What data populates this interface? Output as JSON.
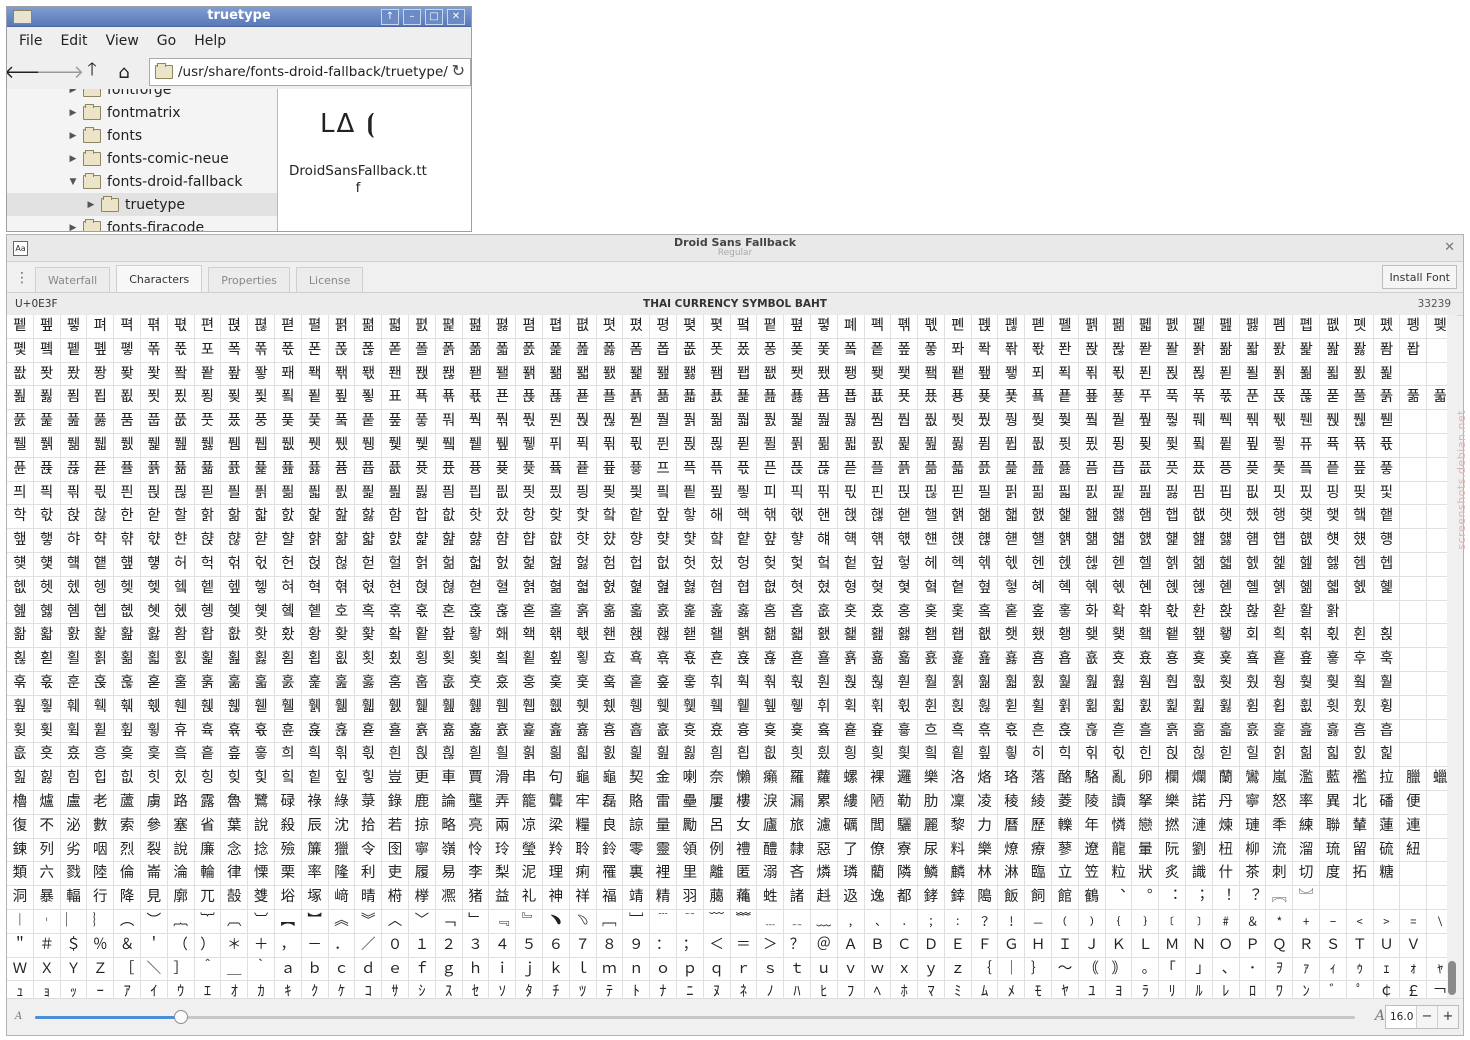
{
  "file_manager": {
    "title": "truetype",
    "menu": [
      "File",
      "Edit",
      "View",
      "Go",
      "Help"
    ],
    "path": "/usr/share/fonts-droid-fallback/truetype/",
    "tree": [
      {
        "label": "fontforge",
        "expanded": false,
        "depth": 0
      },
      {
        "label": "fontmatrix",
        "expanded": false,
        "depth": 0
      },
      {
        "label": "fonts",
        "expanded": false,
        "depth": 0
      },
      {
        "label": "fonts-comic-neue",
        "expanded": false,
        "depth": 0
      },
      {
        "label": "fonts-droid-fallback",
        "expanded": true,
        "depth": 0
      },
      {
        "label": "truetype",
        "expanded": false,
        "depth": 1,
        "selected": true
      },
      {
        "label": "fonts-firacode",
        "expanded": false,
        "depth": 0
      }
    ],
    "file": {
      "preview": "LΔ ⦗",
      "name": "DroidSansFallback.ttf"
    }
  },
  "font_viewer": {
    "title": "Droid Sans Fallback",
    "subtitle": "Regular",
    "tabs": [
      "Waterfall",
      "Characters",
      "Properties",
      "License"
    ],
    "active_tab": "Characters",
    "install_label": "Install Font",
    "codepoint": "U+0E3F",
    "char_name": "THAI CURRENCY SYMBOL BAHT",
    "char_count": "33239",
    "size": "16.0",
    "size_slider_fraction": 0.11,
    "grid_rows": [
      "펱펲펳펴펵펶펷편펹펺펻펼펽펾펿폀폁폂폃폄폅폆폇폈평폊폋폌폍폎폏폐폑폒폓폔폕폖폗폘폙폚폛폜폝폞폟폠폡폢폣폤폥폦",
      "폧폨폩폪폫폮폯포폭폮폯폰폱폲폳폴폵폶폷폸폹폺폻폼폽폾폿퐀퐁퐂퐃퐄퐅퐆퐇퐈퐉퐊퐋퐌퐍퐎퐏퐐퐑퐒퐓퐔퐕퐖퐗퐘퐙",
      "퐚퐛퐜퐝퐞퐟퐠퐡퐢퐣퐤퐥퐦퐧퐨퐩퐪퐫퐬퐭퐮퐯퐰퐱퐲퐳퐴퐵퐶퐷퐸퐹퐺퐻퐼퐽퐾퐿푀푁푂푃푄푅푆푇푈푉푊푋푌푍",
      "푎푏푐푑푒푓푔푕푖푗푘푙푚푛표푝푞푟푠푡푢푣푤푥푦푧푨푩푪푫푬푭푮푯푰푱푲푳푴푵푶푷푸푹푺푻푼푽푾푿풀풁풂풃",
      "풄풅풆풇품풉풊풋풌풍풎풏풐풑풒풓풔풕풖풗풘풙풚풛풜풝풞풟풠풡풢풣풤풥풦풧풨풩풪풫풬풭풮풯풰풱풲풳풴풵풶풷",
      "풸풹풺풻풼풽풾풿퓀퓁퓂퓃퓄퓅퓆퓇퓈퓉퓊퓋퓌퓍퓎퓏퓐퓑퓒퓓퓔퓕퓖퓗퓘퓙퓚퓛퓜퓝퓞퓟퓠퓡퓢퓣퓤퓥퓦퓧퓨퓩퓪퓫",
      "퓬퓭퓮퓯퓰퓱퓲퓳퓴퓵퓶퓷퓸퓹퓺퓻퓼퓽퓾퓿픀픁픂픃프픅픆픇픈픉픊픋플픍픎픏픐픑픒픓픔픕픖픗픘픙픚픛픜픝픞픟",
      "픠픡픢픣픤픥픦픧픨픩픪픫픬픭픮픯픰픱픲픳픴픵픶픷픸픹픺픻피픽픾픿핀핁핂핃필핅핆핇핈핉핊핋핌핍핎핏핐핑핒핓",
      "학핛핝핞한핟할핡핢핣핤핥핦핧함합핪핫핬항핮핯핰핱핲핳해핵핶핷핸핹핺핻핼핽핾핿햀햁햂햃햄햅햆햇했행햊햋햌햍",
      "햎햏햐햑햒햓햔햕햖햗햘햙햚햛햜햝햞햟햠햡햢햣햤향햦햧햨햩햪햫햬햭햮햯햰햱햲햳햴햵햶햷햸햹햺햻햼햽햾햿헀헁",
      "헂헃헄헅헆헇허헉헊헋헌헍헎헏헐헑헒헓헔헕헖헗험헙헚헛헜헝헞헟헠헡헢헣헤헥헦헧헨헩헪헫헬헭헮헯헰헱헲헳헴헵",
      "헶헷헸헹헺헻헼헽헾헿혀혁혂혃현혅혆혇혈혉혊혋혌혍혎혏혐협혒혓혔형혖혗혘혙혚혛혜혝혞혟혠혡혢혣혤혥혦혧혨혩",
      "혪혫혬혭혮혯혰혱혲혳혴혵호혹혺혻혼혽혾혿홀홁홂홃홄홅홆홇홈홉홊홋홌홍홎홏홐홑홒홓화확홖홗환홙홚홛활홝",
      "홞홟홠홡홢홣홤홥홦홧홨황홪홫홬홭홮홯홰홱홲홳홴홵홶홷홸홹홺홻홼홽홾홿횀횁횂횃횄횅횆횇횈횉횊횋회획횎횏횐횑",
      "횒횓횔횕횖횗횘횙횚횛횜횝횞횟횠횡횢횣횤횥횦횧효횩횪횫횬횭횮횯횰횱횲횳횴횵횶횷횸횹횺횻횼횽횾횿훀훁훂훃후훅",
      "훆훇훈훉훊훋훌훍훎훏훐훑훒훓훔훕훖훗훘훙훚훛훜훝훞훟훠훡훢훣훤훥훦훧훨훩훪훫훬훭훮훯훰훱훲훳훴훵훶훷훸훹",
      "훺훻훼훽훾훿휀휁휂휃휄휅휆휇휈휉휊휋휌휍휎휏휐휑휒휓휔휕휖휗휘휙휚휛휜휝휞휟휠휡휢휣휤휥휦휧휨휩휪휫휬휭",
      "휮휯휰휱휲휳휴휵휶휷휸휹휺휻휼휽휾휿흀흁흂흃흄흅흆흇흈흉흊흋흌흍흎흏흐흑흒흓흔흕흖흗흘흙흚흛흜흝흞흟흠흡",
      "흢흣흤흥흦흧흨흩흪흫희흭흮흯흰흱흲흳흴흵흶흷흸흹흺흻흼흽흾흿힀힁힂힃힄힅힆힇히힉힊힋힌힍힎힏힐힑힒힓힔힕",
      "힖힗힘힙힚힛힜힝힞힟힠힡힢힣豈更車賈滑串句龜龜契金喇奈懶癩羅蘿螺裸邏樂洛烙珞落酪駱亂卵欄爛蘭鸞嵐濫藍襤拉臘蠟廊朗浪狼郎來冷勞擄",
      "櫓爐盧老蘆虜路露魯鷺碌祿綠菉錄鹿論壟弄籠聾牢磊賂雷壘屢樓淚漏累縷陋勒肋凜凌稜綾菱陵讀拏樂諾丹寧怒率異北磻便",
      "復不泌數索參塞省葉說殺辰沈拾若掠略亮兩凉梁糧良諒量勵呂女廬旅濾礪閭驪麗黎力曆歷轢年憐戀撚漣煉璉秊練聯輦蓮連",
      "鍊列劣咽烈裂說廉念捻殮簾獵令囹寧嶺怜玲瑩羚聆鈴零靈領例禮醴隸惡了僚寮尿料樂燎療蓼遼龍暈阮劉杻柳流溜琉留硫紐",
      "類六戮陸倫崙淪輪律慄栗率隆利吏履易李梨泥理痢罹裏裡里離匿溺吝燐璘藺隣鱗麟林淋臨立笠粒狀炙識什茶刺切度拓糖",
      "洞暴輻行降見廓兀嗀﨎﨏塚﨑晴﨓﨔凞猪益礼神祥福靖精羽﨟蘒﨡諸﨣﨤逸都﨧﨨﨩飯飼館鶴︑︒︓︔︕︖︗︘",
      "︱︲︳︴︵︶︷︸︹︺︻︼︽︾︿﹀﹁﹂﹃﹄﹅﹆﹇﹈﹉﹊﹋﹌﹍﹎﹏﹐﹑﹒﹔﹕﹖﹗﹘﹙﹚﹛﹜﹝﹞﹟﹠﹡﹢﹣﹤﹥﹦﹨﹩﹪﹫！",
      "＂＃＄％＆＇（）＊＋，－．／０１２３４５６７８９：；＜＝＞？＠ＡＢＣＤＥＦＧＨＩＪＫＬＭＮＯＰＱＲＳＴＵＶ",
      "ＷＸＹＺ［＼］＾＿｀ａｂｃｄｅｆｇｈｉｊｋｌｍｎｏｐｑｒｓｔｕｖｗｘｙｚ｛｜｝～｟｠｡｢｣､･ｦｧｨｩｪｫｬ",
      "ｭｮｯｰｱｲｳｴｵｶｷｸｹｺｻｼｽｾｿﾀﾁﾂﾃﾄﾅﾆﾇﾈﾉﾊﾋﾌﾍﾎﾏﾐﾑﾒﾓﾔﾕﾖﾗﾘﾙﾚﾛﾜﾝﾞﾟ￠￡￢",
      "￣￤￥￦￨￩￪￫￬￭"
    ]
  },
  "watermark": "screenshots.debian.net"
}
